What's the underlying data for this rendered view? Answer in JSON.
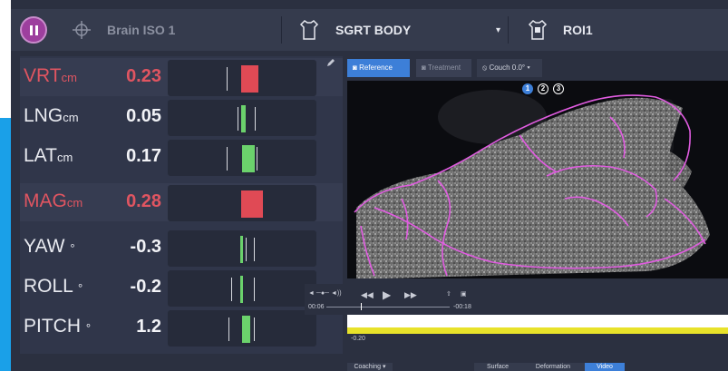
{
  "topbar": {
    "target_label": "Brain ISO 1",
    "body_label": "SGRT BODY",
    "roi_label": "ROI1",
    "dropdown_caret": "▾"
  },
  "rows": [
    {
      "label": "VRT",
      "unit": "cm",
      "value": "0.23",
      "alert": true
    },
    {
      "label": "LNG",
      "unit": "cm",
      "value": "0.05",
      "alert": false
    },
    {
      "label": "LAT",
      "unit": "cm",
      "value": "0.17",
      "alert": false
    },
    {
      "label": "MAG",
      "unit": "cm",
      "value": "0.28",
      "alert": true
    },
    {
      "label": "YAW",
      "unit": "°",
      "value": "-0.3",
      "alert": false
    },
    {
      "label": "ROLL",
      "unit": "°",
      "value": "-0.2",
      "alert": false
    },
    {
      "label": "PITCH",
      "unit": "°",
      "value": "1.2",
      "alert": false
    }
  ],
  "view": {
    "tab_reference": "Reference",
    "tab_treatment": "Treatment",
    "couch_label": "Couch 0.0°",
    "badges": [
      "1",
      "2",
      "3"
    ]
  },
  "player": {
    "time_start": "00:06",
    "time_end": "-00:18"
  },
  "timeline": {
    "value_label": "-0.20"
  },
  "bottom": {
    "coaching_label": "Coaching",
    "tab_surface": "Surface",
    "tab_deformation": "Deformation",
    "tab_video": "Video"
  },
  "colors": {
    "alert": "#e05561",
    "ok": "#6bd26c",
    "accent": "#3d7fd8",
    "pause": "#9d3f9e",
    "contour": "#e05ce0",
    "timeline_signal": "#e8e22a"
  },
  "icons": {
    "pause": "pause-icon",
    "target": "crosshair-icon",
    "body": "body-outline-icon",
    "roi": "roi-body-icon",
    "edit": "pencil-icon",
    "camera": "camera-icon",
    "couch": "couch-icon"
  }
}
